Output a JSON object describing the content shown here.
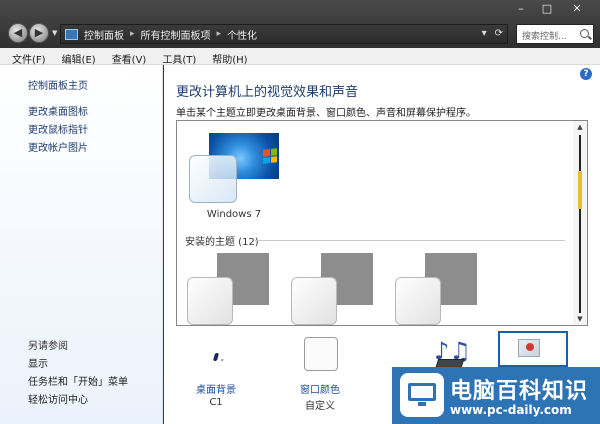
{
  "window": {
    "controls": {
      "minimize": "–",
      "maximize": "□",
      "close": "✕"
    }
  },
  "nav": {
    "back_glyph": "◀",
    "forward_glyph": "▶",
    "dropdown_glyph": "▼"
  },
  "address": {
    "crumbs": [
      "控制面板",
      "所有控制面板项",
      "个性化"
    ],
    "separator": "▸",
    "dropdown_glyph": "▾",
    "refresh_glyph": "⟳"
  },
  "search": {
    "placeholder": "搜索控制..."
  },
  "menu": {
    "items": [
      "文件(F)",
      "编辑(E)",
      "查看(V)",
      "工具(T)",
      "帮助(H)"
    ]
  },
  "sidebar": {
    "home": "控制面板主页",
    "links": [
      "更改桌面图标",
      "更改鼠标指针",
      "更改帐户图片"
    ],
    "see_also_title": "另请参阅",
    "see_also_links": [
      "显示",
      "任务栏和「开始」菜单",
      "轻松访问中心"
    ]
  },
  "main": {
    "help_glyph": "?",
    "title": "更改计算机上的视觉效果和声音",
    "subtitle": "单击某个主题立即更改桌面背景、窗口颜色、声音和屏幕保护程序。",
    "current_theme": {
      "name": "Windows 7"
    },
    "installed_group": "安装的主题 (12)",
    "scroll": {
      "up": "▲",
      "down": "▼"
    }
  },
  "bottom": {
    "desktop_background": {
      "label": "桌面背景",
      "value": "C1"
    },
    "window_color": {
      "label": "窗口颜色",
      "value": "自定义"
    },
    "sound_glyph": "♪♫"
  },
  "watermark": {
    "title": "电脑百科知识",
    "url": "www.pc-daily.com"
  },
  "colors": {
    "accent_link": "#1e4ea0",
    "scroll_thumb": "#e8bf2f",
    "watermark_bg": "#2e74b5"
  }
}
